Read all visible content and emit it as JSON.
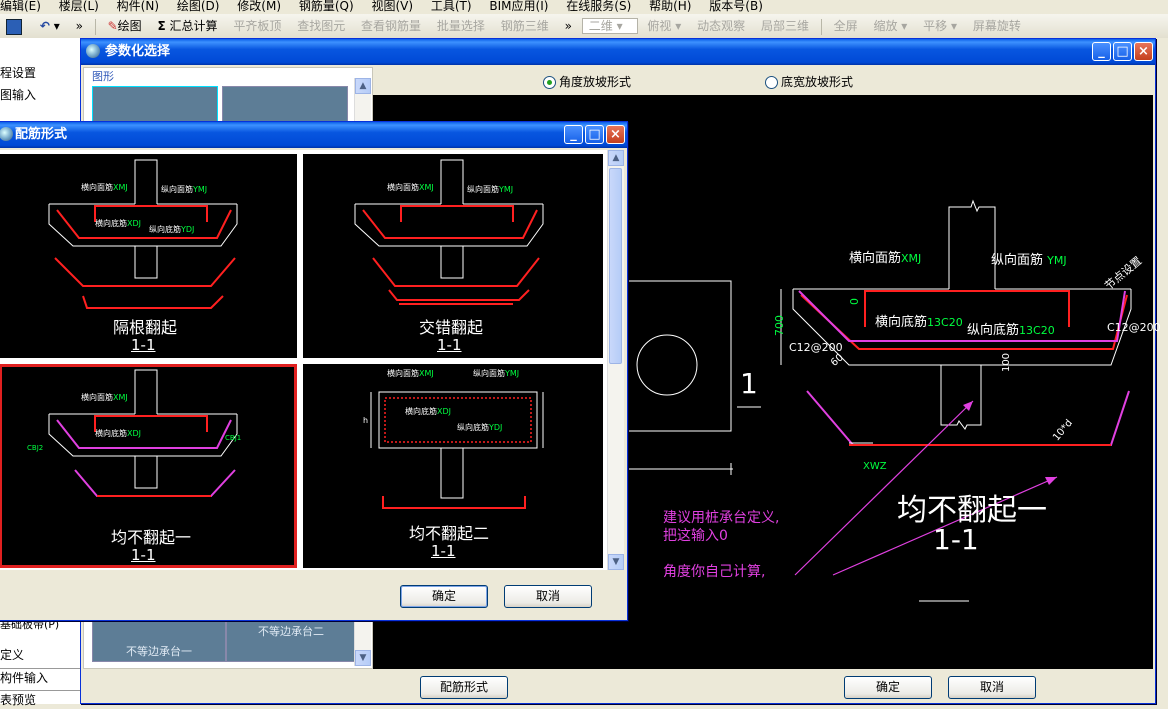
{
  "menu": [
    "编辑(E)",
    "楼层(L)",
    "构件(N)",
    "绘图(D)",
    "修改(M)",
    "钢筋量(Q)",
    "视图(V)",
    "工具(T)",
    "BIM应用(I)",
    "在线服务(S)",
    "帮助(H)",
    "版本号(B)"
  ],
  "toolbar": {
    "draw": "绘图",
    "sum": "汇总计算",
    "items": [
      "平齐板顶",
      "查找图元",
      "查看钢筋量",
      "批量选择",
      "钢筋三维",
      "二维",
      "俯视",
      "动态观察",
      "局部三维",
      "全屏",
      "缩放",
      "平移",
      "屏幕旋转"
    ]
  },
  "left_nav": {
    "items": [
      "程设置",
      "图输入"
    ],
    "bottom": [
      "基础板带(P)",
      "定义",
      "构件输入",
      "表预览"
    ]
  },
  "param_dialog": {
    "title": "参数化选择",
    "group_label": "图形",
    "radio_angle": "角度放坡形式",
    "radio_width": "底宽放坡形式",
    "thumb_labels": [
      "不等边承台一",
      "不等边承台二"
    ],
    "rebar_button": "配筋形式",
    "ok": "确定",
    "cancel": "取消"
  },
  "drawing": {
    "section_label": "1",
    "top_lbl_h": "横向面筋",
    "top_code_h": "XMJ",
    "top_lbl_v": "纵向面筋",
    "top_code_v": "YMJ",
    "bot_lbl_h": "横向底筋",
    "bot_code_h": "13C20",
    "bot_lbl_v": "纵向底筋",
    "bot_code_v": "13C20",
    "side": "节点设置",
    "dim_700": "700",
    "dim_0": "0",
    "rebar_c12_left": "C12@200",
    "rebar_c12_right": "C12@200",
    "angle": "60",
    "dim_100": "100",
    "xwz": "XWZ",
    "anchor": "10*d",
    "title": "均不翻起一",
    "subtitle": "1-1",
    "note1": "建议用桩承台定义,",
    "note2": "把这输入0",
    "note3": "角度你自己计算,"
  },
  "rebar_dialog": {
    "title": "配筋形式",
    "options": [
      {
        "name": "隔根翻起",
        "section": "1-1"
      },
      {
        "name": "交错翻起",
        "section": "1-1"
      },
      {
        "name": "均不翻起一",
        "section": "1-1"
      },
      {
        "name": "均不翻起二",
        "section": "1-1"
      }
    ],
    "mini_lbl_th": "横向面筋",
    "mini_code_th": "XMJ",
    "mini_lbl_tv": "纵向面筋",
    "mini_code_tv": "YMJ",
    "mini_lbl_bh": "横向底筋",
    "mini_code_bh": "XDJ",
    "mini_lbl_bv": "纵向底筋",
    "mini_code_bv": "YDJ",
    "mini_side": "节点设置",
    "mini_xmj": "XMJ",
    "mini_ymj": "YMJ",
    "mini_cbj": "CBJ",
    "mini_cbj1": "CBJ1",
    "mini_cbj2": "CBJ2",
    "mini_xwz": "XWZ",
    "mini_h": "h",
    "ok": "确定",
    "cancel": "取消"
  },
  "colors": {
    "red": "#FF2020",
    "green": "#00FF40",
    "magenta": "#E040E0",
    "white": "#FFFFFF"
  }
}
